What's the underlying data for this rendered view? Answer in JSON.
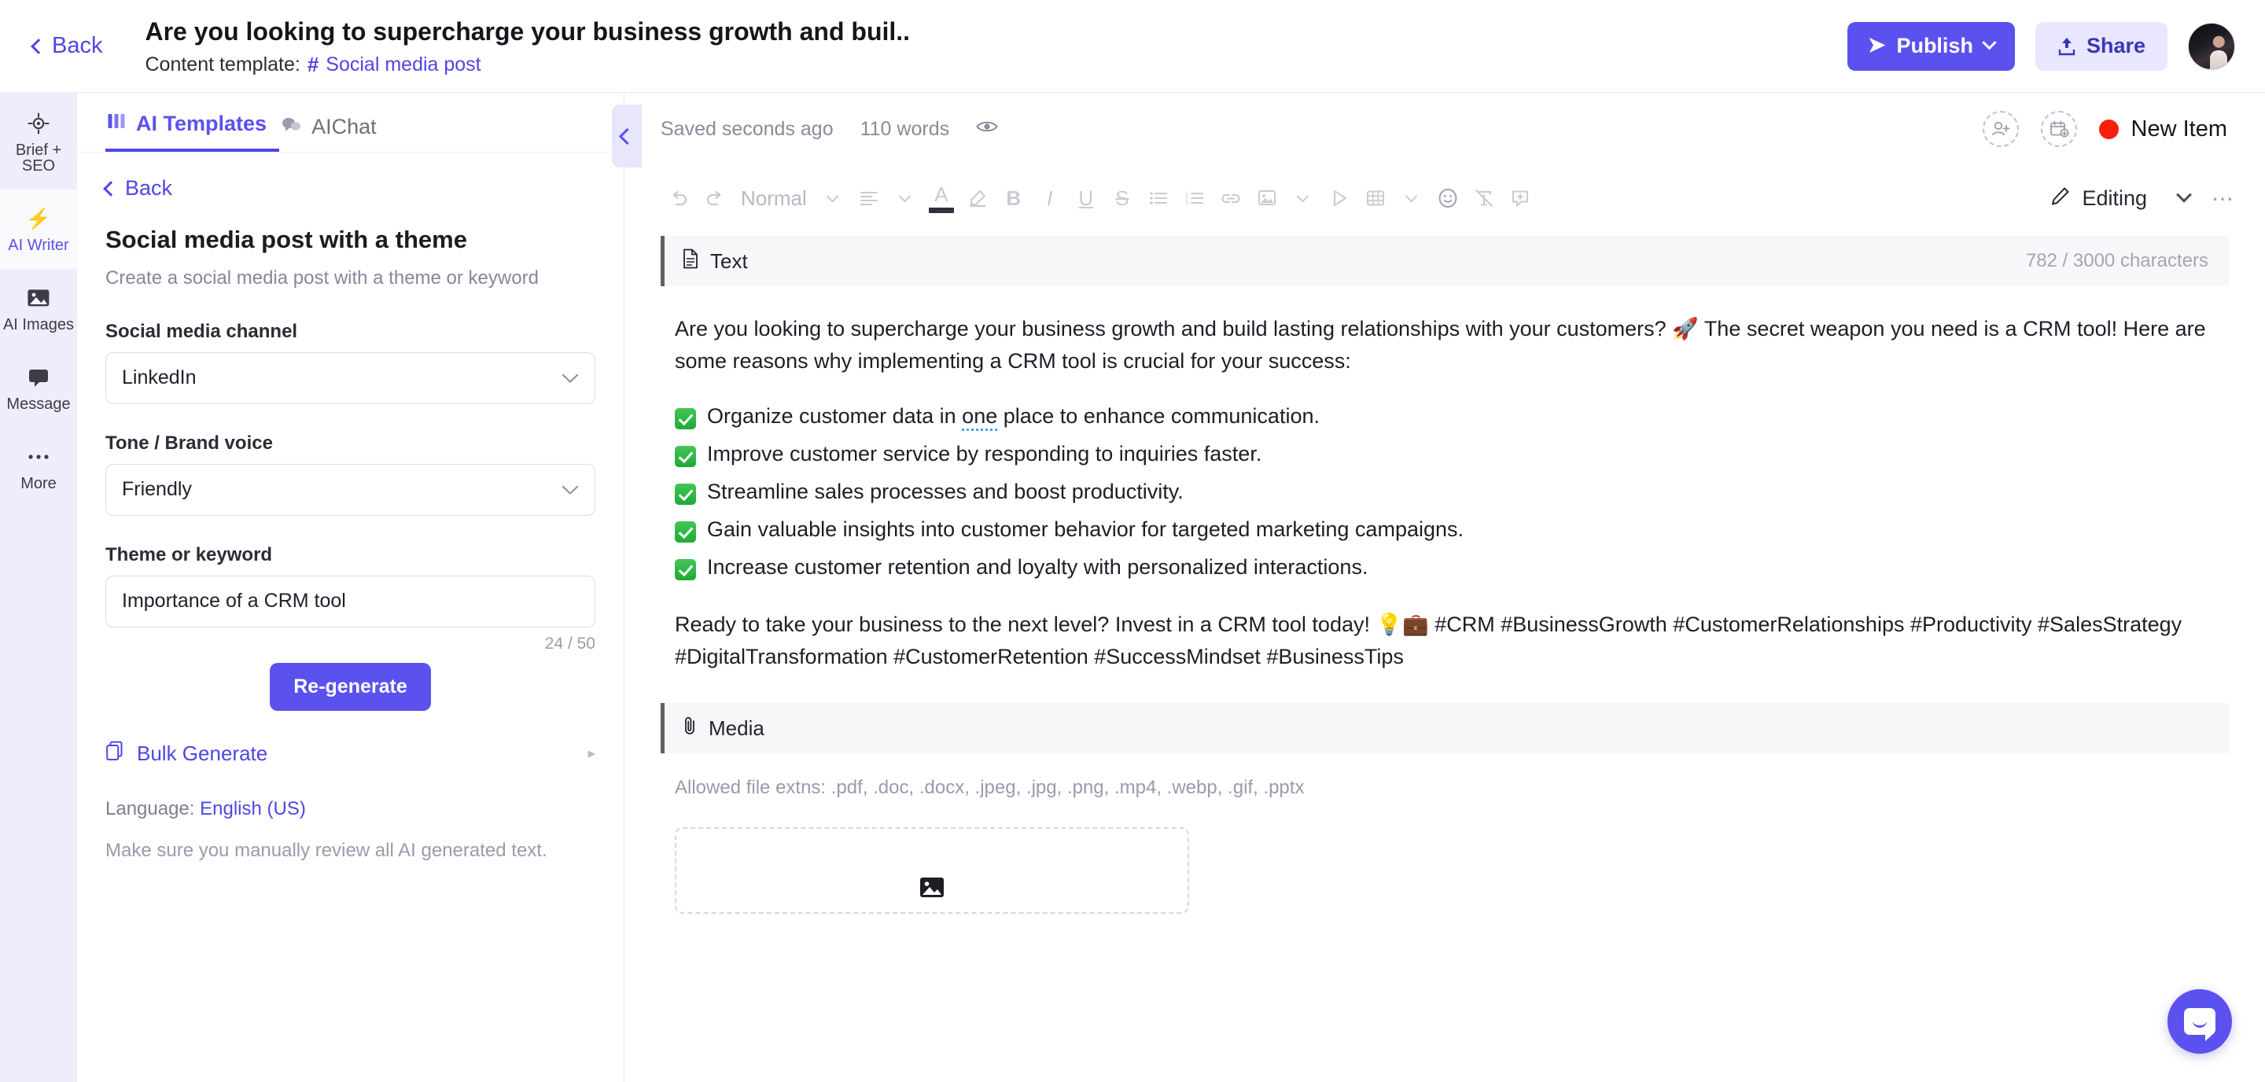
{
  "header": {
    "back_label": "Back",
    "doc_title": "Are you looking to supercharge your business growth and buil..",
    "template_prefix": "Content template:",
    "template_hash": "#",
    "template_name": "Social media post",
    "publish_label": "Publish",
    "publish_icon": "send-icon",
    "share_label": "Share",
    "share_icon": "upload-icon",
    "avatar_name": "user-avatar",
    "accent_color": "#5b51ef",
    "share_bg_color": "#e8e7fd"
  },
  "rail": {
    "items": [
      {
        "label": "Brief + SEO",
        "icon": "target-icon",
        "glyph": "⊕",
        "active": false
      },
      {
        "label": "AI Writer",
        "icon": "lightning-icon",
        "glyph": "⚡",
        "active": true
      },
      {
        "label": "AI Images",
        "icon": "image-icon",
        "glyph": "🖼",
        "active": false
      },
      {
        "label": "Message",
        "icon": "chat-icon",
        "glyph": "💬",
        "active": false
      },
      {
        "label": "More",
        "icon": "ellipsis-icon",
        "glyph": "•••",
        "active": false
      }
    ]
  },
  "panel": {
    "tabs": [
      {
        "label": "AI Templates",
        "icon": "templates-icon",
        "glyph": "░",
        "active": true
      },
      {
        "label": "AIChat",
        "icon": "chat-bubbles-icon",
        "glyph": "💭",
        "active": false
      }
    ],
    "collapse_icon": "chevron-left-icon",
    "back_label": "Back",
    "template_title": "Social media post with a theme",
    "template_desc": "Create a social media post with a theme or keyword",
    "fields": [
      {
        "label": "Social media channel",
        "value": "LinkedIn",
        "type": "select",
        "name": "social-media-channel"
      },
      {
        "label": "Tone / Brand voice",
        "value": "Friendly",
        "type": "select",
        "name": "tone-brand-voice"
      },
      {
        "label": "Theme or keyword",
        "value": "Importance of a CRM tool",
        "type": "text",
        "name": "theme-or-keyword"
      }
    ],
    "char_counter": "24 / 50",
    "regenerate_label": "Re-generate",
    "bulk_label": "Bulk Generate",
    "bulk_icon": "copy-icon",
    "bulk_arrow": "▸",
    "language_prefix": "Language:",
    "language_value": "English (US)",
    "disclaimer": "Make sure you manually review all AI generated text."
  },
  "editor": {
    "saved_status": "Saved seconds ago",
    "word_count": "110 words",
    "eye_icon": "eye-icon",
    "add_person_icon": "add-person-icon",
    "add_date_icon": "add-date-icon",
    "new_item_label": "New Item",
    "new_item_dot_color": "#f8200c",
    "toolbar": {
      "undo_icon": "undo-icon",
      "redo_icon": "redo-icon",
      "style_value": "Normal",
      "align_icon": "align-left-icon",
      "text_color_icon": "text-color-icon",
      "highlight_icon": "highlighter-icon",
      "bold_label": "B",
      "italic_label": "I",
      "underline_label": "U",
      "strike_label": "S",
      "bullet_list_icon": "bullet-list-icon",
      "numbered_list_icon": "numbered-list-icon",
      "link_icon": "link-icon",
      "image_icon": "image-icon",
      "video_icon": "video-play-icon",
      "table_icon": "table-icon",
      "emoji_icon": "emoji-icon",
      "clear_format_icon": "clear-format-icon",
      "comment_icon": "add-comment-icon",
      "mode_label": "Editing",
      "mode_icon": "pencil-icon",
      "more_icon": "more-options-icon"
    },
    "text_section": {
      "title": "Text",
      "icon": "document-icon",
      "characters": "782 / 3000 characters",
      "intro_a": "Are you looking to supercharge your business growth and build lasting relationships with your customers? 🚀 The secret weapon you need is a CRM tool! Here are some reasons why implementing a CRM tool is crucial for your success:",
      "bullets": [
        {
          "pre": "Organize customer data in ",
          "spell": "one",
          "post": " place to enhance communication."
        },
        {
          "pre": "Improve customer service by responding to inquiries faster.",
          "spell": "",
          "post": ""
        },
        {
          "pre": "Streamline sales processes and boost productivity.",
          "spell": "",
          "post": ""
        },
        {
          "pre": "Gain valuable insights into customer behavior for targeted marketing campaigns.",
          "spell": "",
          "post": ""
        },
        {
          "pre": "Increase customer retention and loyalty with personalized interactions.",
          "spell": "",
          "post": ""
        }
      ],
      "outro": "Ready to take your business to the next level? Invest in a CRM tool today! 💡💼 #CRM #BusinessGrowth #CustomerRelationships #Productivity #SalesStrategy #DigitalTransformation #CustomerRetention #SuccessMindset #BusinessTips"
    },
    "media_section": {
      "title": "Media",
      "icon": "paperclip-icon",
      "allowed": "Allowed file extns: .pdf, .doc, .docx, .jpeg, .jpg, .png, .mp4, .webp, .gif, .pptx",
      "dropzone_icon": "image-placeholder-icon"
    }
  },
  "chat_fab": {
    "icon": "intercom-chat-icon",
    "color": "#5b51ef"
  }
}
